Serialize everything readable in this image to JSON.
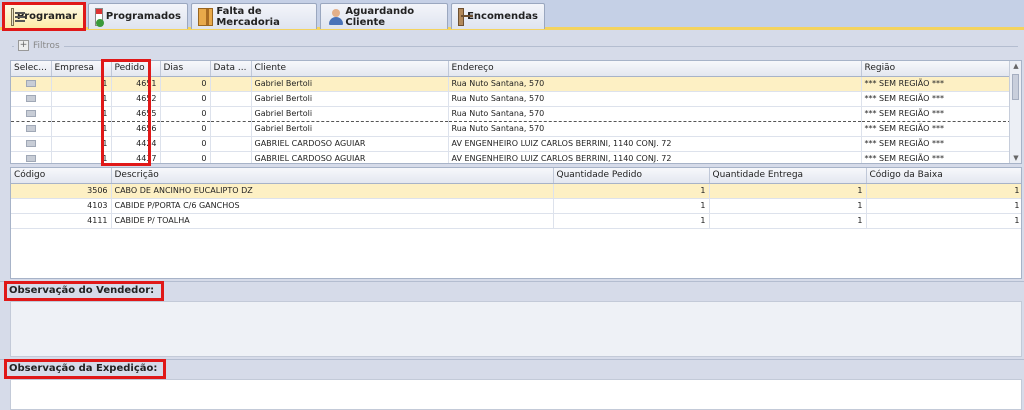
{
  "tabs": [
    {
      "label": "Programar",
      "icon": "schedule-icon",
      "active": true
    },
    {
      "label": "Programados",
      "icon": "calendar-icon",
      "active": false
    },
    {
      "label": "Falta de Mercadoria",
      "icon": "box-icon",
      "active": false
    },
    {
      "label": "Aguardando Cliente",
      "icon": "user-icon",
      "active": false
    },
    {
      "label": "Encomendas",
      "icon": "package-icon",
      "active": false
    }
  ],
  "filters": {
    "label": "Filtros"
  },
  "orders": {
    "columns": [
      "Selec...",
      "Empresa",
      "Pedido",
      "Dias",
      "Data ...",
      "Cliente",
      "Endereço",
      "Região"
    ],
    "rows": [
      [
        "",
        "1",
        "4651",
        "0",
        "",
        "Gabriel Bertoli",
        "Rua Nuto Santana, 570",
        "*** SEM REGIÃO ***"
      ],
      [
        "",
        "1",
        "4652",
        "0",
        "",
        "Gabriel Bertoli",
        "Rua Nuto Santana, 570",
        "*** SEM REGIÃO ***"
      ],
      [
        "",
        "1",
        "4655",
        "0",
        "",
        "Gabriel Bertoli",
        "Rua Nuto Santana, 570",
        "*** SEM REGIÃO ***"
      ],
      [
        "",
        "1",
        "4656",
        "0",
        "",
        "Gabriel Bertoli",
        "Rua Nuto Santana, 570",
        "*** SEM REGIÃO ***"
      ],
      [
        "",
        "1",
        "4424",
        "0",
        "",
        "GABRIEL CARDOSO AGUIAR",
        "AV ENGENHEIRO LUIZ CARLOS BERRINI, 1140 CONJ. 72",
        "*** SEM REGIÃO ***"
      ],
      [
        "",
        "1",
        "4437",
        "0",
        "",
        "GABRIEL CARDOSO AGUIAR",
        "AV ENGENHEIRO LUIZ CARLOS BERRINI, 1140 CONJ. 72",
        "*** SEM REGIÃO ***"
      ]
    ]
  },
  "items": {
    "columns": [
      "Código",
      "Descrição",
      "Quantidade Pedido",
      "Quantidade Entrega",
      "Código da Baixa"
    ],
    "rows": [
      [
        "3506",
        "CABO DE ANCINHO EUCALIPTO DZ",
        "1",
        "1",
        "1"
      ],
      [
        "4103",
        "CABIDE P/PORTA C/6 GANCHOS",
        "1",
        "1",
        "1"
      ],
      [
        "4111",
        "CABIDE P/ TOALHA",
        "1",
        "1",
        "1"
      ]
    ]
  },
  "observacao_vendedor": {
    "title": "Observação do Vendedor:",
    "value": ""
  },
  "observacao_expedicao": {
    "title": "Observação da Expedição:",
    "value": ""
  },
  "colors": {
    "accent": "#f4d35e",
    "highlight": "#e01818",
    "selected_row": "#fdf0c4"
  }
}
